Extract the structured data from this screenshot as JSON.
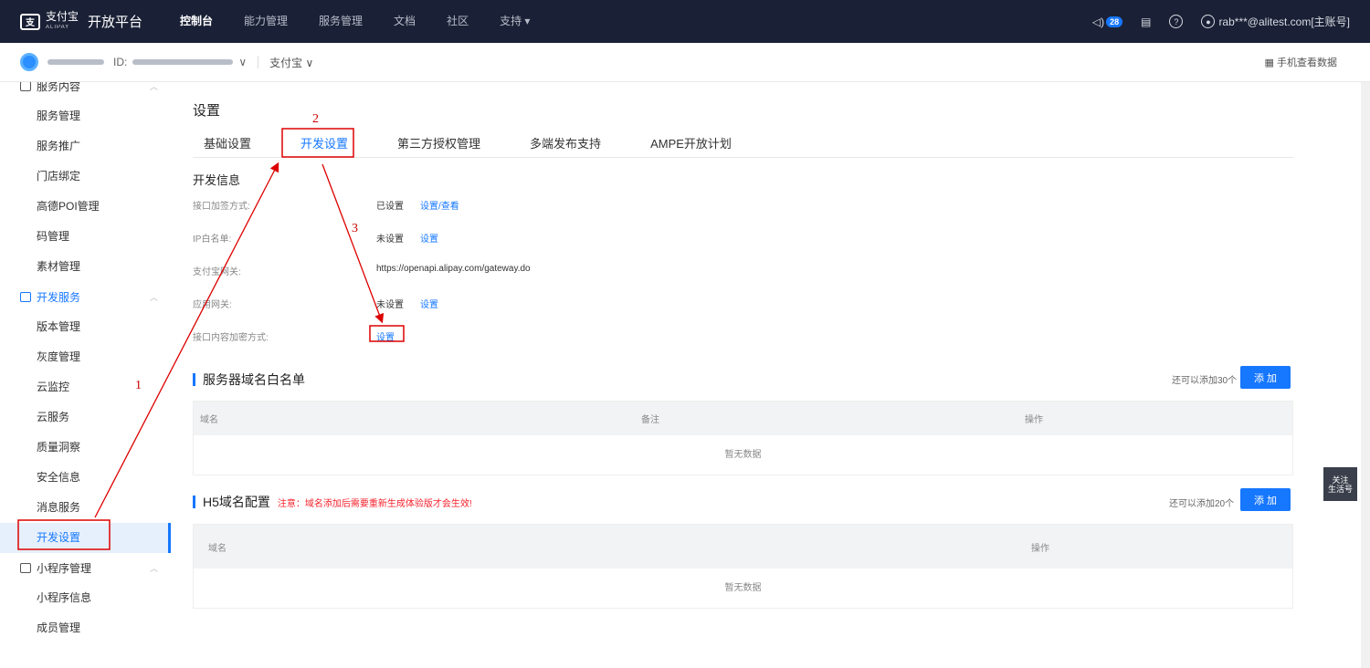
{
  "topbar": {
    "brand_cn": "支付宝",
    "brand_en": "ALIPAY",
    "platform": "开放平台",
    "nav": [
      "控制台",
      "能力管理",
      "服务管理",
      "文档",
      "社区",
      "支持 ▾"
    ],
    "notification_count": "28",
    "account": "rab***@alitest.com[主账号]",
    "icons": [
      "speaker-icon",
      "document-icon",
      "help-icon",
      "user-icon"
    ]
  },
  "subbar": {
    "id_label": "ID:",
    "app_type": "支付宝",
    "mobile_view": "手机查看数据"
  },
  "sidebar": {
    "group_service": "服务内容",
    "service_items": [
      "服务管理",
      "服务推广",
      "门店绑定",
      "高德POI管理",
      "码管理",
      "素材管理"
    ],
    "group_dev": "开发服务",
    "dev_items": [
      "版本管理",
      "灰度管理",
      "云监控",
      "云服务",
      "质量洞察",
      "安全信息",
      "消息服务",
      "开发设置"
    ],
    "group_mini": "小程序管理",
    "mini_items": [
      "小程序信息",
      "成员管理"
    ]
  },
  "main": {
    "title": "设置",
    "tabs": [
      "基础设置",
      "开发设置",
      "第三方授权管理",
      "多端发布支持",
      "AMPE开放计划"
    ],
    "dev_info_title": "开发信息",
    "rows": [
      {
        "label": "接口加签方式:",
        "value": "已设置",
        "link": "设置/查看"
      },
      {
        "label": "IP白名单:",
        "value": "未设置",
        "link": "设置"
      },
      {
        "label": "支付宝网关:",
        "value": "https://openapi.alipay.com/gateway.do",
        "link": ""
      },
      {
        "label": "应用网关:",
        "value": "未设置",
        "link": "设置"
      },
      {
        "label": "接口内容加密方式:",
        "value": "",
        "link": "设置"
      }
    ],
    "server_whitelist": {
      "title": "服务器域名白名单",
      "remain": "还可以添加30个",
      "add": "添 加",
      "columns": [
        "域名",
        "备注",
        "操作"
      ],
      "empty": "暂无数据"
    },
    "h5": {
      "title": "H5域名配置",
      "warning": "注意：域名添加后需要重新生成体验版才会生效!",
      "remain": "还可以添加20个",
      "add": "添 加",
      "columns": [
        "域名",
        "操作"
      ],
      "empty": "暂无数据"
    }
  },
  "float_button": {
    "line1": "关注",
    "line2": "生活号"
  },
  "annotations": {
    "n1": "1",
    "n2": "2",
    "n3": "3",
    "color": "#dd0000"
  }
}
